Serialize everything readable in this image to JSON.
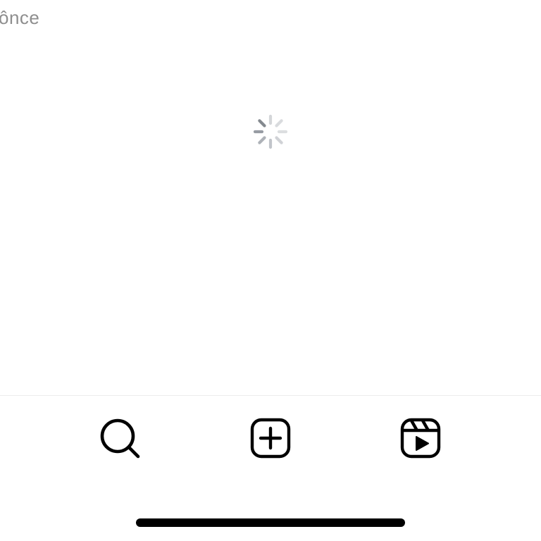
{
  "header": {
    "partial_label": "ônce"
  },
  "loading": {
    "spinner_icon": "loading-spinner-icon",
    "spinner_color": "#8e8e8e"
  },
  "tab_bar": {
    "items": [
      {
        "icon": "search-icon"
      },
      {
        "icon": "create-post-icon"
      },
      {
        "icon": "reels-icon"
      }
    ]
  },
  "colors": {
    "background": "#ffffff",
    "icon": "#000000",
    "muted_text": "#8e8e8e",
    "divider": "#ededed"
  }
}
